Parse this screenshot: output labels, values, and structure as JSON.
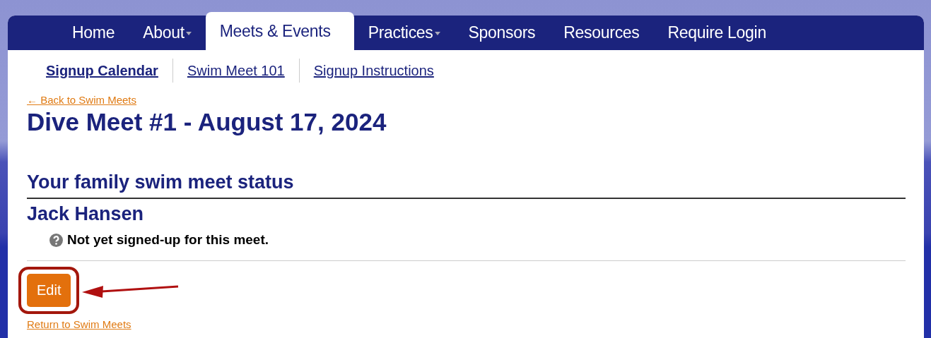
{
  "nav": [
    {
      "label": "Home",
      "dropdown": false,
      "selected": false
    },
    {
      "label": "About",
      "dropdown": true,
      "selected": false
    },
    {
      "label": "Meets & Events",
      "dropdown": false,
      "selected": true
    },
    {
      "label": "Practices",
      "dropdown": true,
      "selected": false
    },
    {
      "label": "Sponsors",
      "dropdown": false,
      "selected": false
    },
    {
      "label": "Resources",
      "dropdown": false,
      "selected": false
    },
    {
      "label": "Require Login",
      "dropdown": false,
      "selected": false
    }
  ],
  "subnav": [
    {
      "label": "Signup Calendar",
      "selected": true
    },
    {
      "label": "Swim Meet 101",
      "selected": false
    },
    {
      "label": "Signup Instructions",
      "selected": false
    }
  ],
  "back_link": "← Back to Swim Meets",
  "title": "Dive Meet #1 - August 17, 2024",
  "section_heading": "Your family swim meet status",
  "swimmers": [
    {
      "name": "Jack Hansen",
      "status": "Not yet signed-up for this meet."
    }
  ],
  "edit_button": "Edit",
  "return_link": "Return to Swim Meets"
}
